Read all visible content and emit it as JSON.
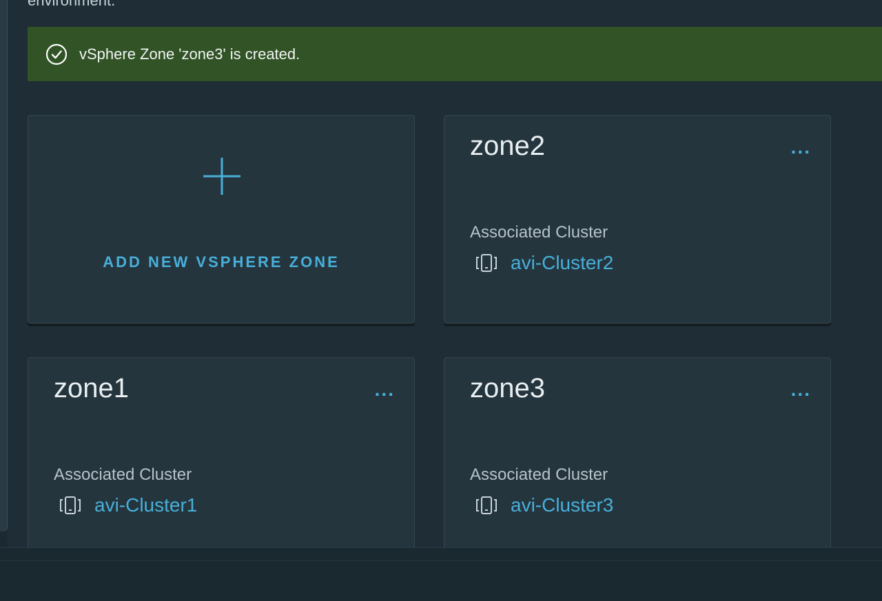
{
  "intro": {
    "text": "environment."
  },
  "alert": {
    "message": "vSphere Zone 'zone3' is created.",
    "color": "#315326"
  },
  "add_card": {
    "label": "ADD NEW VSPHERE ZONE"
  },
  "zones": [
    {
      "name": "zone2",
      "menu": "...",
      "assoc_label": "Associated Cluster",
      "cluster": "avi-Cluster2"
    },
    {
      "name": "zone1",
      "menu": "...",
      "assoc_label": "Associated Cluster",
      "cluster": "avi-Cluster1"
    },
    {
      "name": "zone3",
      "menu": "...",
      "assoc_label": "Associated Cluster",
      "cluster": "avi-Cluster3"
    }
  ],
  "colors": {
    "accent": "#49afd9",
    "success": "#315326",
    "card": "#24353e",
    "background": "#1e2d36"
  }
}
